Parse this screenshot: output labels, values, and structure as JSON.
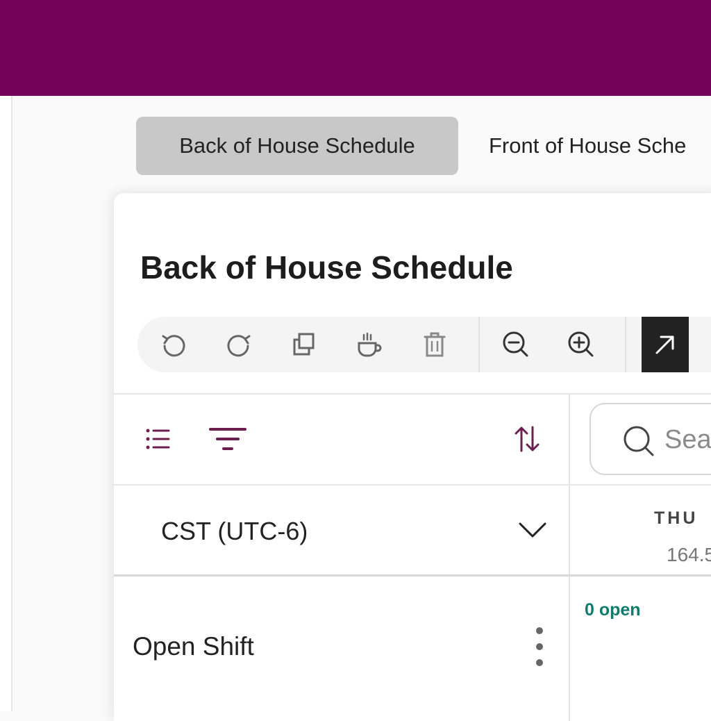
{
  "tabs": [
    {
      "label": "Back of House Schedule",
      "active": true
    },
    {
      "label": "Front of House Sche",
      "active": false
    }
  ],
  "schedule": {
    "title": "Back of House Schedule",
    "toolbar": {
      "icons": [
        "undo-icon",
        "redo-icon",
        "copy-icon",
        "break-icon",
        "trash-icon",
        "zoom-out-icon",
        "zoom-in-icon",
        "expand-icon"
      ]
    },
    "controls": {
      "icons": [
        "list-view-icon",
        "filter-icon",
        "sort-icon"
      ]
    },
    "search": {
      "placeholder": "Sea"
    },
    "timezone": {
      "label": "CST (UTC-6)"
    },
    "day": {
      "label": "THU",
      "hours": "164.5"
    },
    "open_shift_row": {
      "label": "Open Shift",
      "open_count": "0 open"
    }
  },
  "colors": {
    "brand": "#75005a",
    "accent_icon": "#6b1f4e",
    "open_count": "#0e7c6b"
  }
}
